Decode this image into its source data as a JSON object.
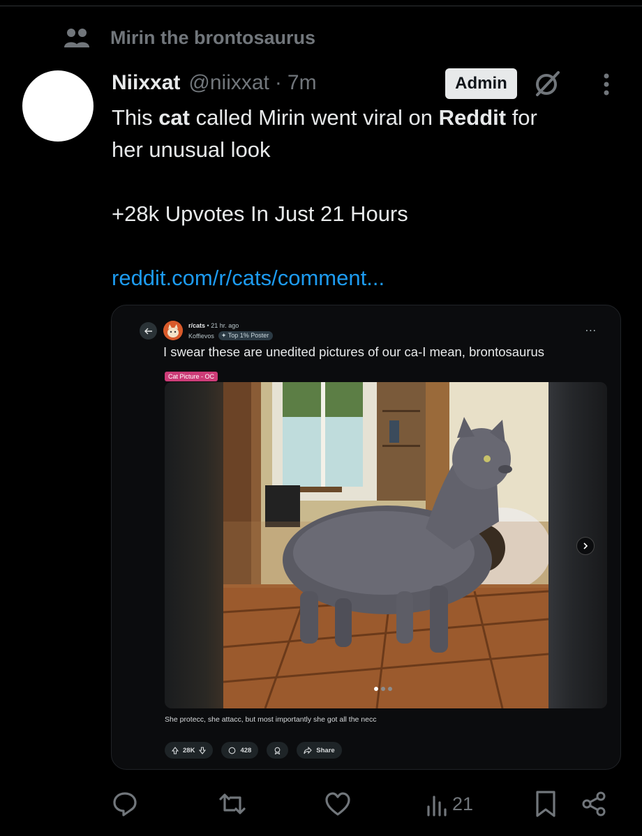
{
  "community": {
    "label": "Mirin the brontosaurus",
    "icon": "community-icon"
  },
  "post": {
    "author_name": "Niixxat",
    "author_handle": "@niixxat",
    "separator": "·",
    "time": "7m",
    "admin_badge": "Admin",
    "text": {
      "l1_a": "This ",
      "l1_b": "cat",
      "l1_c": " called Mirin went viral on ",
      "l1_d": "Reddit",
      "l1_e": " for",
      "l2": "her unusual look",
      "l3": "+28k Upvotes In Just 21 Hours",
      "link": "reddit.com/r/cats/comment..."
    }
  },
  "reddit": {
    "subreddit": "r/cats",
    "age": "• 21 hr. ago",
    "user": "Koffievos",
    "user_badge": "Top 1% Poster",
    "more": "...",
    "title": "I swear these are unedited pictures of our ca-I mean, brontosaurus",
    "flair": "Cat Picture - OC",
    "caption": "She protecc, she attacc, but most importantly she got all the necc",
    "upvotes": "28K",
    "comments": "428",
    "share": "Share",
    "carousel_pages": 3,
    "carousel_current": 1
  },
  "actions": {
    "views": "21"
  },
  "colors": {
    "background": "#000000",
    "text": "#e7e9ea",
    "muted": "#71767b",
    "link": "#1d9bf0",
    "flair": "#cc3c77"
  }
}
